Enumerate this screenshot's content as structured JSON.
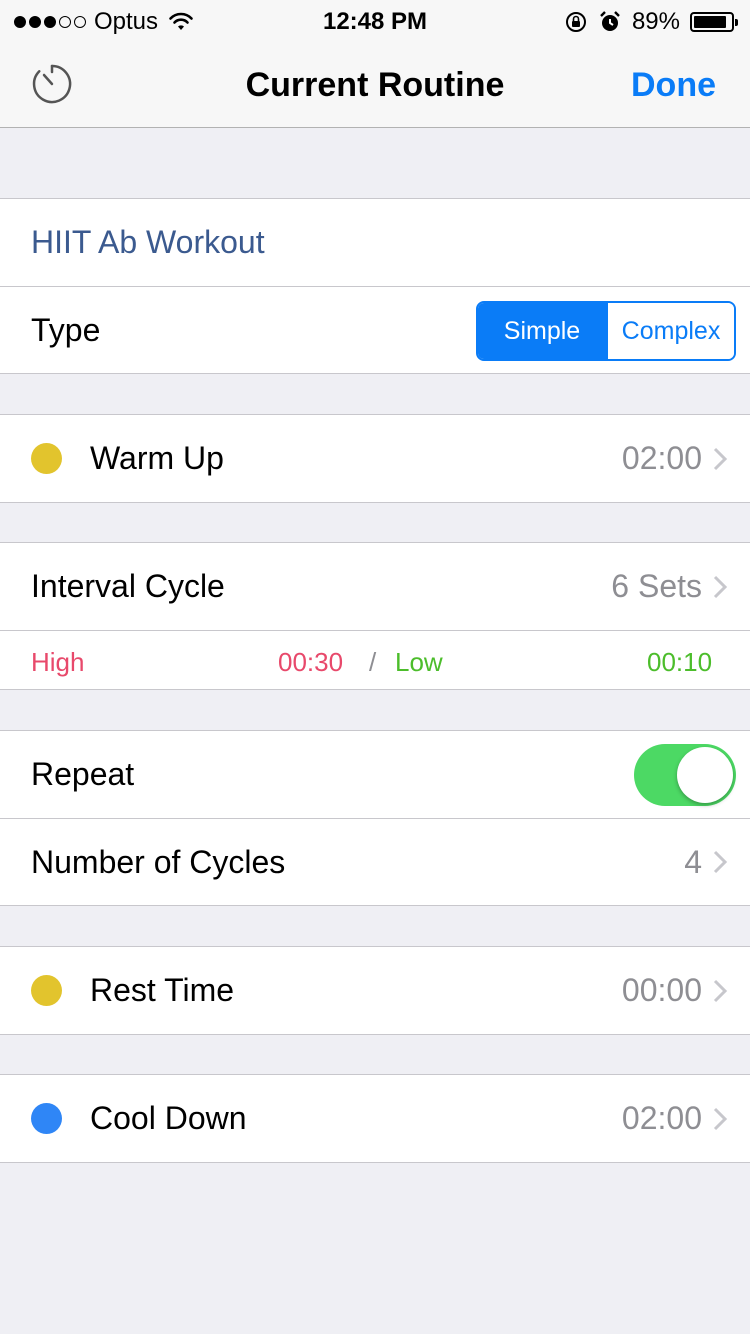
{
  "status_bar": {
    "carrier": "Optus",
    "time": "12:48 PM",
    "battery": "89%",
    "battery_level": 0.89,
    "signal_bars_filled": 3,
    "signal_bars_total": 5
  },
  "nav": {
    "title": "Current Routine",
    "done_label": "Done",
    "left_icon": "timer-icon"
  },
  "routine": {
    "name": "HIIT Ab Workout",
    "type_label": "Type",
    "type_options": [
      "Simple",
      "Complex"
    ],
    "type_selected": "Simple"
  },
  "warm_up": {
    "label": "Warm Up",
    "value": "02:00",
    "color": "#e2c42d"
  },
  "interval": {
    "label": "Interval Cycle",
    "value": "6 Sets",
    "high_label": "High",
    "high_time": "00:30",
    "separator": "/",
    "low_label": "Low",
    "low_time": "00:10",
    "high_color": "#e8496b",
    "low_color": "#4cbd2b"
  },
  "repeat": {
    "label": "Repeat",
    "enabled": true
  },
  "cycles": {
    "label": "Number of Cycles",
    "value": "4"
  },
  "rest": {
    "label": "Rest Time",
    "value": "00:00",
    "color": "#e2c42d"
  },
  "cool_down": {
    "label": "Cool Down",
    "value": "02:00",
    "color": "#2f86f6"
  },
  "colors": {
    "accent": "#0a7cf7",
    "toggle_on": "#4cd964"
  }
}
